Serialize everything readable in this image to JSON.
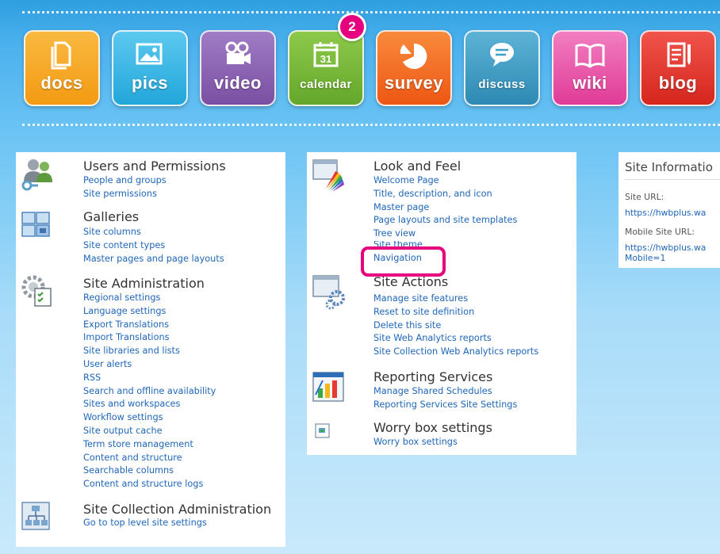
{
  "step_badge": "2",
  "tiles": [
    {
      "label": "docs",
      "icon": "docs-icon",
      "color": "#f7a51b"
    },
    {
      "label": "pics",
      "icon": "pics-icon",
      "color": "#35b6e4"
    },
    {
      "label": "video",
      "icon": "video-icon",
      "color": "#8b5fb0"
    },
    {
      "label": "calendar",
      "icon": "calendar-icon",
      "color": "#7dbb3c"
    },
    {
      "label": "survey",
      "icon": "survey-icon",
      "color": "#f36b21"
    },
    {
      "label": "discuss",
      "icon": "discuss-icon",
      "color": "#3b9fc7"
    },
    {
      "label": "wiki",
      "icon": "wiki-icon",
      "color": "#ec4fa6"
    },
    {
      "label": "blog",
      "icon": "blog-icon",
      "color": "#e6332a"
    }
  ],
  "calendar_day": "31",
  "col1": {
    "users": {
      "title": "Users and Permissions",
      "links": [
        "People and groups",
        "Site permissions"
      ]
    },
    "galleries": {
      "title": "Galleries",
      "links": [
        "Site columns",
        "Site content types",
        "Master pages and page layouts"
      ]
    },
    "admin": {
      "title": "Site Administration",
      "links": [
        "Regional settings",
        "Language settings",
        "Export Translations",
        "Import Translations",
        "Site libraries and lists",
        "User alerts",
        "RSS",
        "Search and offline availability",
        "Sites and workspaces",
        "Workflow settings",
        "Site output cache",
        "Term store management",
        "Content and structure",
        "Searchable columns",
        "Content and structure logs"
      ]
    },
    "collection": {
      "title": "Site Collection Administration",
      "links": [
        "Go to top level site settings"
      ]
    }
  },
  "col2": {
    "look": {
      "title": "Look and Feel",
      "links": [
        "Welcome Page",
        "Title, description, and icon",
        "Master page",
        "Page layouts and site templates",
        "Tree view",
        "Site theme",
        "Navigation"
      ]
    },
    "actions": {
      "title": "Site Actions",
      "links": [
        "Manage site features",
        "Reset to site definition",
        "Delete this site",
        "Site Web Analytics reports",
        "Site Collection Web Analytics reports"
      ]
    },
    "reporting": {
      "title": "Reporting Services",
      "links": [
        "Manage Shared Schedules",
        "Reporting Services Site Settings"
      ]
    },
    "worry": {
      "title": "Worry box settings",
      "links": [
        "Worry box settings"
      ]
    }
  },
  "info": {
    "title": "Site Informatio",
    "site_url_label": "Site URL:",
    "site_url_value": "https://hwbplus.wa",
    "mobile_url_label": "Mobile Site URL:",
    "mobile_url_value_1": "https://hwbplus.wa",
    "mobile_url_value_2": "Mobile=1"
  }
}
